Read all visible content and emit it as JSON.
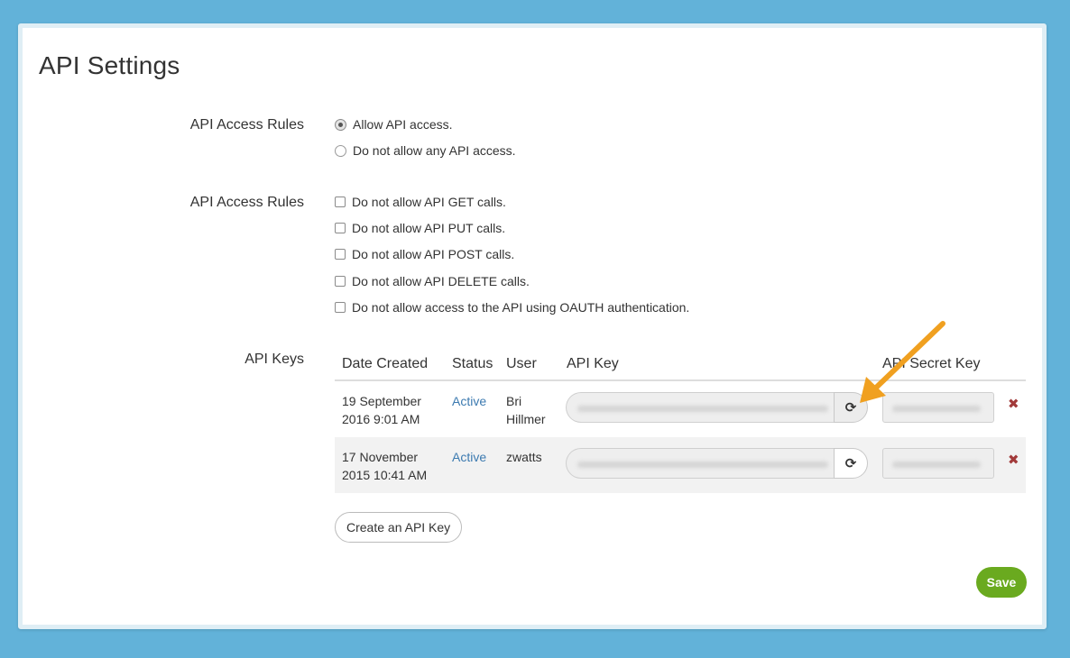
{
  "page_title": "API Settings",
  "access_rules": {
    "label": "API Access Rules",
    "options": [
      {
        "label": "Allow API access.",
        "checked": true
      },
      {
        "label": "Do not allow any API access.",
        "checked": false
      }
    ]
  },
  "method_rules": {
    "label": "API Access Rules",
    "options": [
      {
        "label": "Do not allow API GET calls.",
        "checked": false
      },
      {
        "label": "Do not allow API PUT calls.",
        "checked": false
      },
      {
        "label": "Do not allow API POST calls.",
        "checked": false
      },
      {
        "label": "Do not allow API DELETE calls.",
        "checked": false
      },
      {
        "label": "Do not allow access to the API using OAUTH authentication.",
        "checked": false
      }
    ]
  },
  "api_keys": {
    "label": "API Keys",
    "columns": [
      "Date Created",
      "Status",
      "User",
      "API Key",
      "API Secret Key"
    ],
    "rows": [
      {
        "date_line1": "19 September",
        "date_line2": "2016 9:01 AM",
        "status": "Active",
        "user_line1": "Bri",
        "user_line2": "Hillmer"
      },
      {
        "date_line1": "17 November",
        "date_line2": "2015 10:41 AM",
        "status": "Active",
        "user_line1": "zwatts",
        "user_line2": ""
      }
    ],
    "refresh_icon": "refresh-icon",
    "delete_icon": "delete-icon",
    "delete_glyph": "✖",
    "refresh_glyph": "⟳"
  },
  "create_button": "Create an API Key",
  "save_button": "Save",
  "colors": {
    "background": "#62b2d9",
    "link": "#3c7ab0",
    "save": "#6aaa1f",
    "delete": "#a23a3a",
    "arrow": "#f0a020"
  }
}
